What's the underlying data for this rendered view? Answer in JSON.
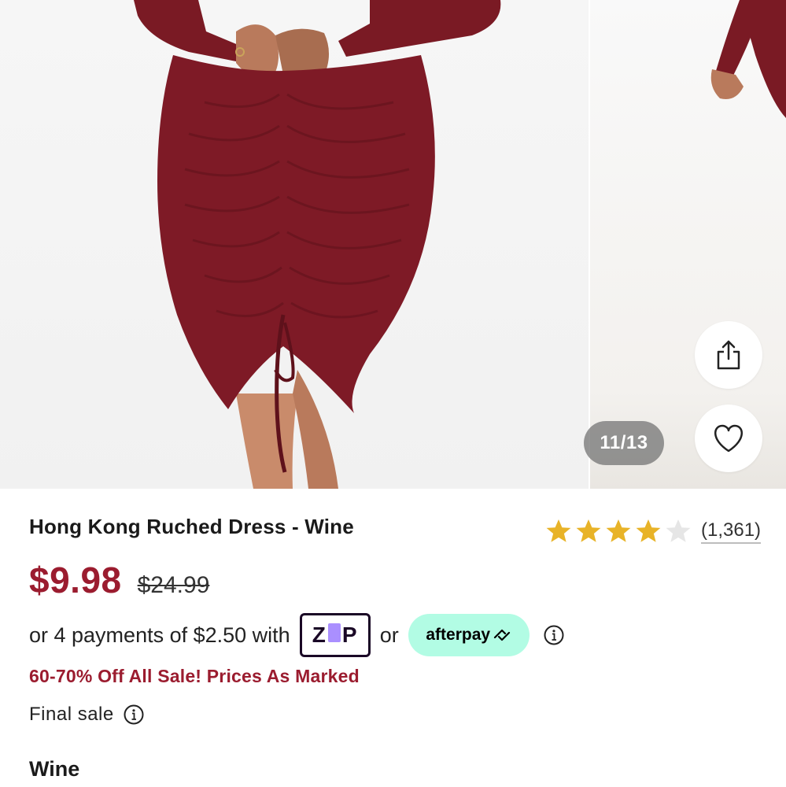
{
  "gallery": {
    "counter": "11/13",
    "main_image_icon": "dress-photo",
    "next_image_icon": "dress-photo",
    "share_icon": "share-icon",
    "favorite_icon": "heart-icon"
  },
  "product": {
    "title": "Hong Kong Ruched Dress - Wine",
    "rating": 4,
    "rating_max": 5,
    "review_count": "(1,361)",
    "sale_price": "$9.98",
    "original_price": "$24.99",
    "installments_text": "or 4 payments of $2.50 with",
    "zip_label": "Z P",
    "or_text": "or",
    "afterpay_label": "afterpay",
    "promo": "60-70% Off All Sale! Prices As Marked",
    "final_sale": "Final sale",
    "color": "Wine"
  },
  "colors": {
    "accent": "#9b1c2f",
    "dress": "#7e1a26",
    "star": "#e8b328",
    "afterpay_bg": "#b2fce4",
    "zip_purple": "#aa8fff"
  }
}
